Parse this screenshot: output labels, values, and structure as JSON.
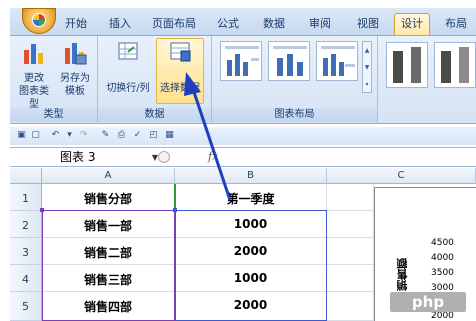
{
  "tabs": {
    "home": "开始",
    "insert": "插入",
    "page_layout": "页面布局",
    "formulas": "公式",
    "data": "数据",
    "review": "审阅",
    "view": "视图",
    "design": "设计",
    "layout": "布局"
  },
  "ribbon": {
    "change_type_l1": "更改",
    "change_type_l2": "图表类型",
    "save_as_l1": "另存为",
    "save_as_l2": "模板",
    "type_group": "类型",
    "switch_rowcol": "切换行/列",
    "select_data": "选择数据",
    "data_group": "数据",
    "chart_layouts_group": "图表布局"
  },
  "namebox": {
    "value": "图表 3"
  },
  "formula": {
    "fx": "fx"
  },
  "columns": [
    "A",
    "B",
    "C"
  ],
  "rows": [
    {
      "num": "1",
      "a": "销售分部",
      "b": "第一季度"
    },
    {
      "num": "2",
      "a": "销售一部",
      "b": "1000"
    },
    {
      "num": "3",
      "a": "销售二部",
      "b": "2000"
    },
    {
      "num": "4",
      "a": "销售三部",
      "b": "1000"
    },
    {
      "num": "5",
      "a": "销售四部",
      "b": "2000"
    }
  ],
  "chart": {
    "yticks": [
      "4500",
      "4000",
      "3500",
      "3000",
      "2500",
      "2000"
    ],
    "ylabel": "销售额"
  },
  "watermark": "php",
  "colors": {
    "ribbon_bg": "#d5e3f5",
    "highlight": "#ffe08a",
    "arrow": "#1f3fbf",
    "selection": "#3b5bd6"
  }
}
